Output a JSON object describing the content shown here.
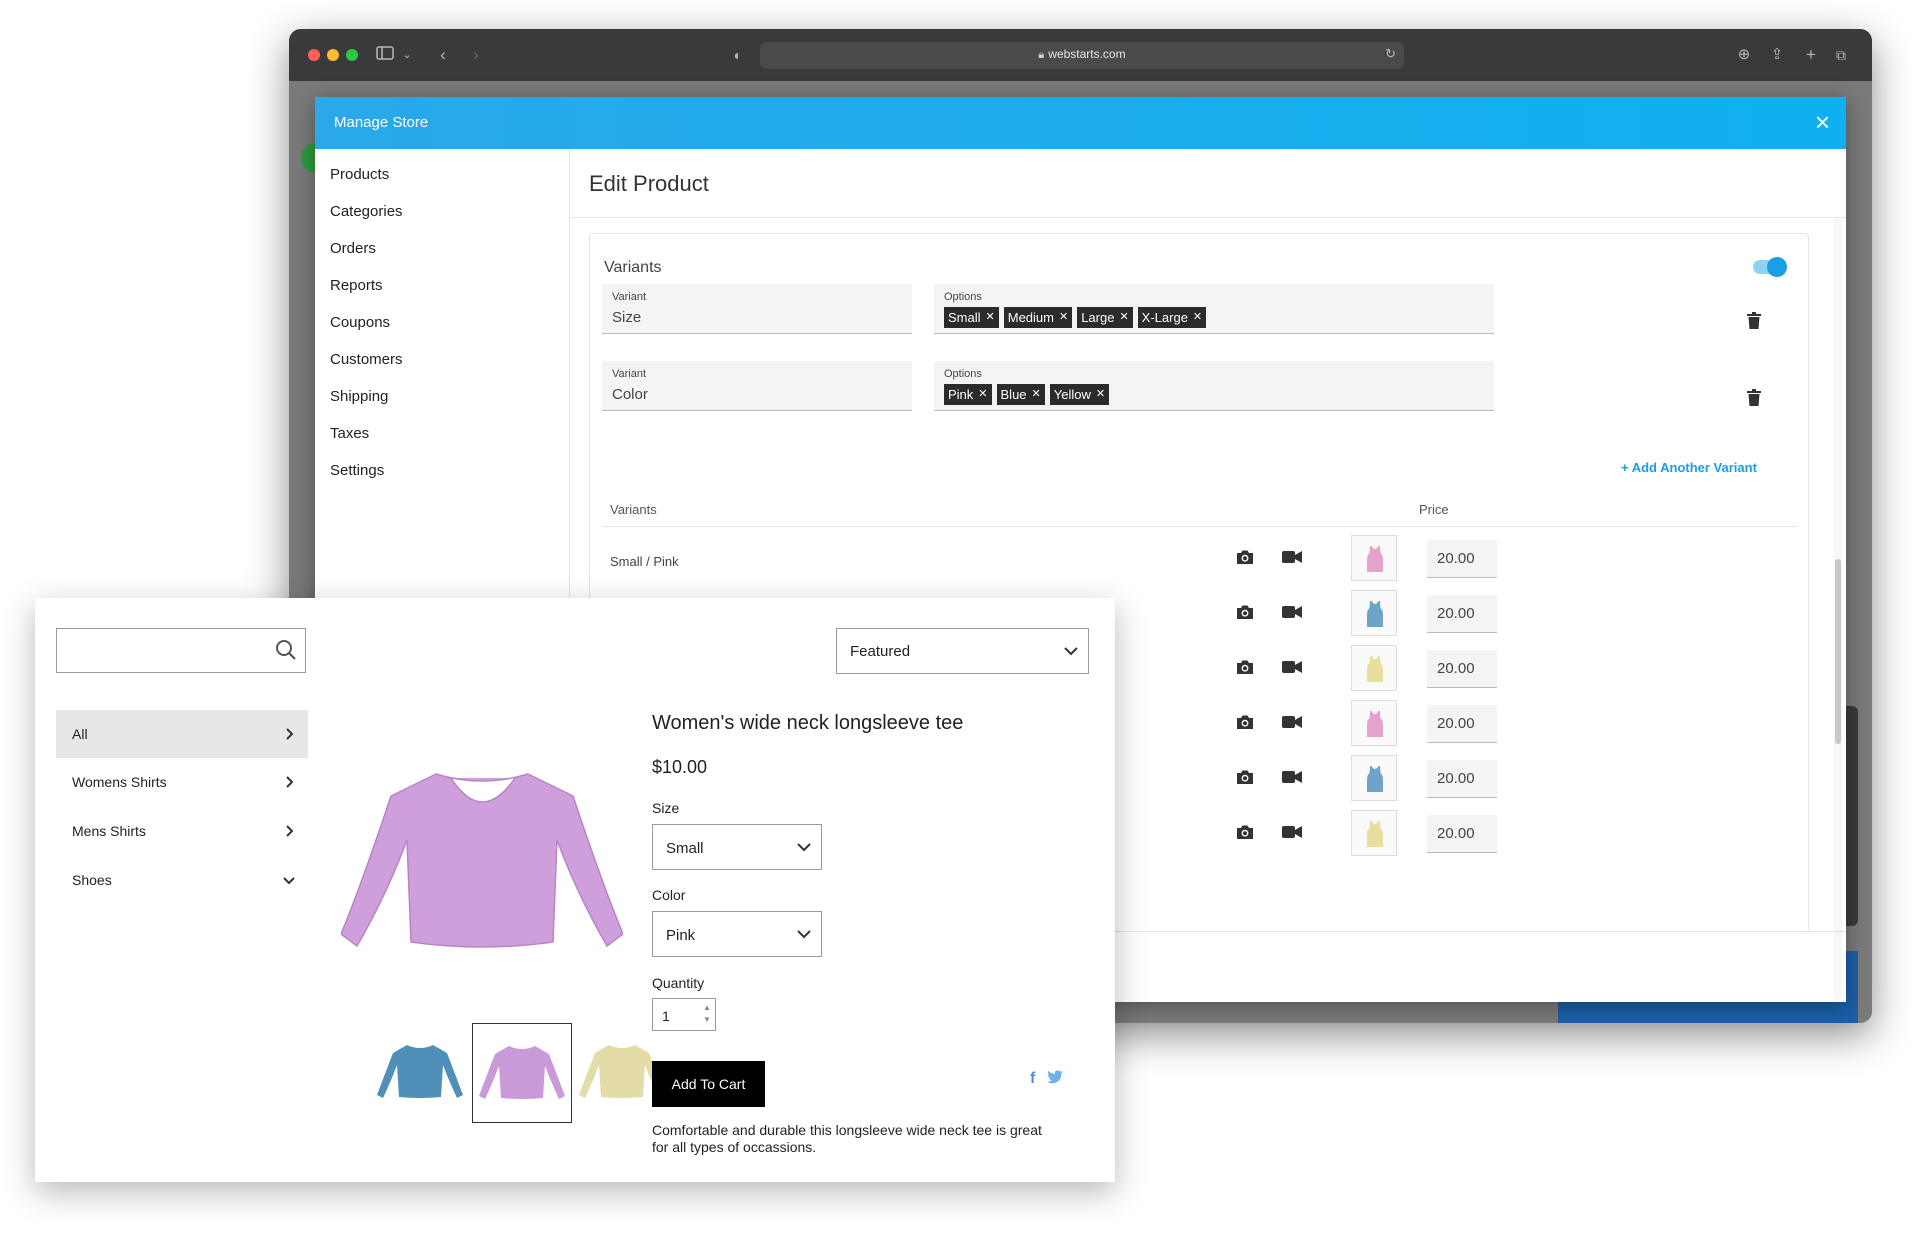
{
  "browser": {
    "url": "webstarts.com",
    "icons": [
      "sidebar-icon",
      "back-icon",
      "forward-icon",
      "shield-icon",
      "lock-icon",
      "reload-icon",
      "download-icon",
      "share-icon",
      "new-tab-icon",
      "tabs-icon"
    ]
  },
  "modal": {
    "title": "Manage Store",
    "close_label": "×",
    "accent_color": "#1aa9ee"
  },
  "sidebar": {
    "items": [
      {
        "label": "Products"
      },
      {
        "label": "Categories"
      },
      {
        "label": "Orders"
      },
      {
        "label": "Reports"
      },
      {
        "label": "Coupons"
      },
      {
        "label": "Customers"
      },
      {
        "label": "Shipping"
      },
      {
        "label": "Taxes"
      },
      {
        "label": "Settings"
      }
    ]
  },
  "editor": {
    "title": "Edit Product",
    "variants_heading": "Variants",
    "variants_enabled": true,
    "variant_label": "Variant",
    "options_label": "Options",
    "variant_groups": [
      {
        "name": "Size",
        "options": [
          "Small",
          "Medium",
          "Large",
          "X-Large"
        ]
      },
      {
        "name": "Color",
        "options": [
          "Pink",
          "Blue",
          "Yellow"
        ]
      }
    ],
    "add_variant_label": "+ Add Another Variant",
    "table": {
      "col_variants": "Variants",
      "col_price": "Price",
      "rows": [
        {
          "label": "Small / Pink",
          "price": "20.00",
          "color": "#e3a3cc"
        },
        {
          "label": "",
          "price": "20.00",
          "color": "#6ea4c8"
        },
        {
          "label": "",
          "price": "20.00",
          "color": "#e7df9c"
        },
        {
          "label": "",
          "price": "20.00",
          "color": "#e3a3cc"
        },
        {
          "label": "",
          "price": "20.00",
          "color": "#6ea4c8"
        },
        {
          "label": "",
          "price": "20.00",
          "color": "#e7df9c"
        }
      ]
    }
  },
  "store": {
    "search_placeholder": "",
    "sort": "Featured",
    "categories": [
      {
        "label": "All",
        "active": true,
        "icon": "chevron-right-icon"
      },
      {
        "label": "Womens Shirts",
        "active": false,
        "icon": "chevron-right-icon"
      },
      {
        "label": "Mens Shirts",
        "active": false,
        "icon": "chevron-right-icon"
      },
      {
        "label": "Shoes",
        "active": false,
        "icon": "chevron-down-icon"
      }
    ],
    "product": {
      "title": "Women's wide neck longsleeve tee",
      "price": "$10.00",
      "size_label": "Size",
      "size_value": "Small",
      "color_label": "Color",
      "color_value": "Pink",
      "quantity_label": "Quantity",
      "quantity_value": "1",
      "add_to_cart": "Add To Cart",
      "description": "Comfortable and durable this longsleeve wide neck tee is great for all types of occassions.",
      "gallery_colors": [
        "#4f8fb8",
        "#c99ad8",
        "#e3dba8"
      ],
      "selected_gallery_index": 1,
      "main_color": "#cf9fdc",
      "social": {
        "facebook": "f",
        "twitter": "🐦"
      }
    }
  }
}
